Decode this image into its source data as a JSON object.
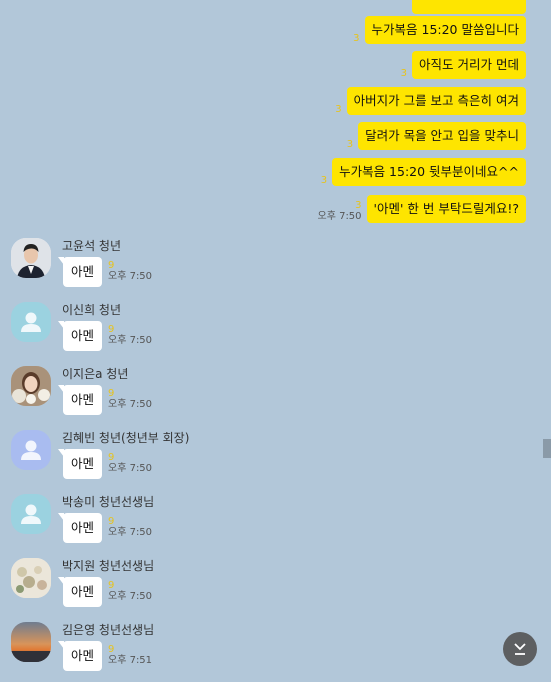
{
  "outgoing": [
    {
      "text": "누가복음 15:20 말씀입니다",
      "unread": "3",
      "time": ""
    },
    {
      "text": "아직도 거리가 먼데",
      "unread": "3",
      "time": ""
    },
    {
      "text": "아버지가 그를 보고 측은히 여겨",
      "unread": "3",
      "time": ""
    },
    {
      "text": "달려가 목을 안고 입을 맞추니",
      "unread": "3",
      "time": ""
    },
    {
      "text": "누가복음 15:20 뒷부분이네요^^",
      "unread": "3",
      "time": ""
    },
    {
      "text": "'아멘' 한 번 부탁드릴게요!?",
      "unread": "3",
      "time": "오후 7:50"
    }
  ],
  "incoming": [
    {
      "name": "고윤석 청년",
      "text": "아멘",
      "unread": "9",
      "time": "오후 7:50",
      "avatar": "photo-man-suit"
    },
    {
      "name": "이신희 청년",
      "text": "아멘",
      "unread": "9",
      "time": "오후 7:50",
      "avatar": "default-person"
    },
    {
      "name": "이지은a 청년",
      "text": "아멘",
      "unread": "9",
      "time": "오후 7:50",
      "avatar": "photo-woman"
    },
    {
      "name": "김혜빈 청년(청년부 회장)",
      "text": "아멘",
      "unread": "9",
      "time": "오후 7:50",
      "avatar": "default-person"
    },
    {
      "name": "박송미 청년선생님",
      "text": "아멘",
      "unread": "9",
      "time": "오후 7:50",
      "avatar": "default-person"
    },
    {
      "name": "박지원 청년선생님",
      "text": "아멘",
      "unread": "9",
      "time": "오후 7:50",
      "avatar": "photo-flowers"
    },
    {
      "name": "김은영 청년선생님",
      "text": "아멘",
      "unread": "9",
      "time": "오후 7:51",
      "avatar": "photo-sunset"
    }
  ],
  "scroll_down_icon": "chevron-down-to-bottom-icon",
  "colors": {
    "background": "#b2c7d9",
    "outgoing_bubble": "#fee500",
    "incoming_bubble": "#ffffff"
  }
}
